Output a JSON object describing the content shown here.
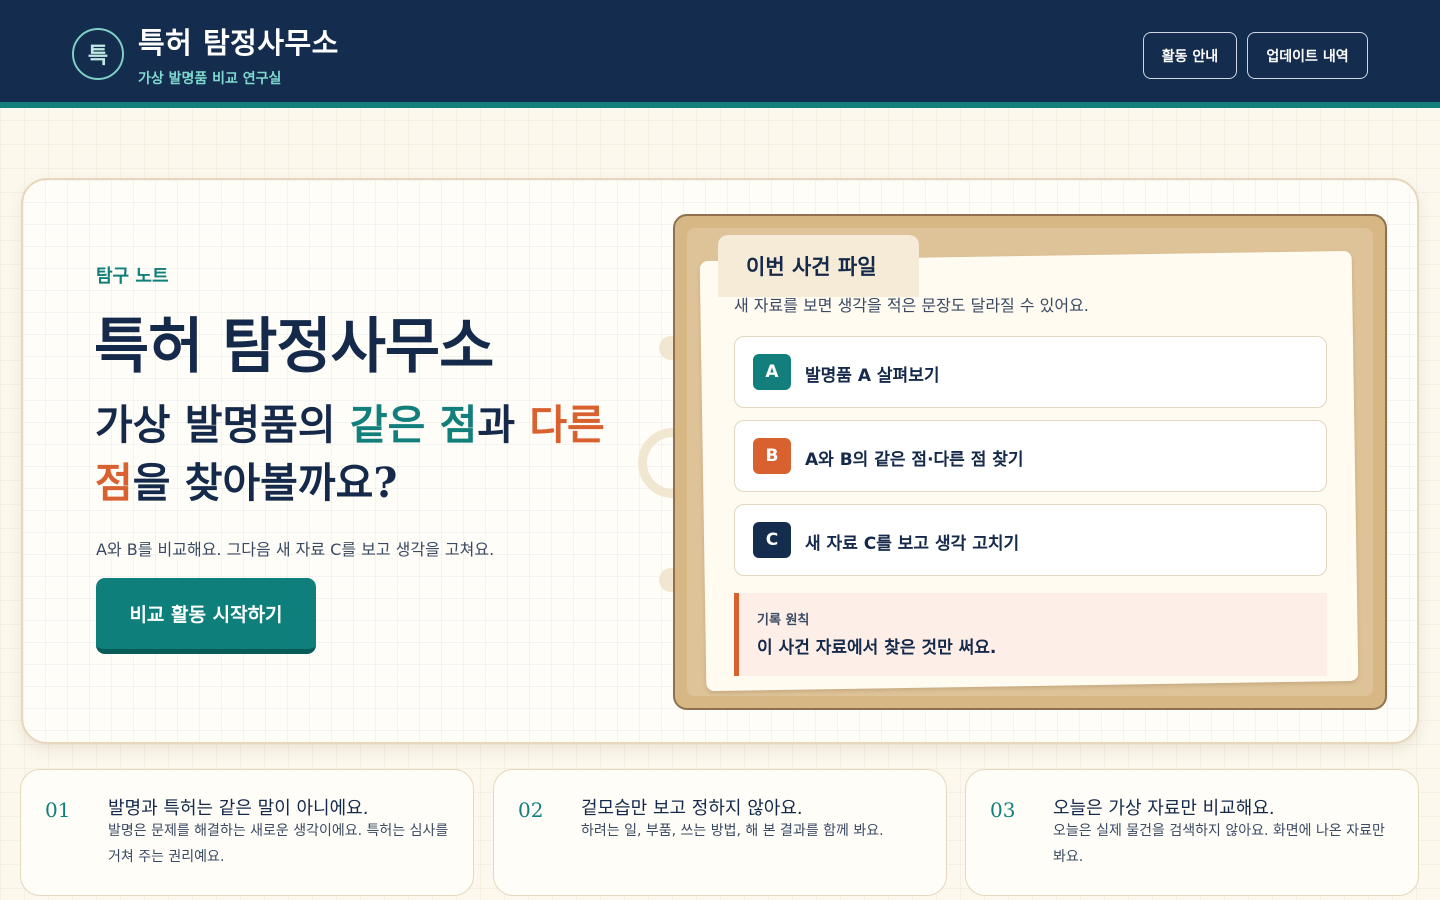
{
  "header": {
    "logo_glyph": "특",
    "title": "특허 탐정사무소",
    "subtitle": "가상 발명품 비교 연구실",
    "nav": [
      {
        "label": "활동 안내"
      },
      {
        "label": "업데이트 내역"
      }
    ]
  },
  "hero": {
    "eyebrow": "탐구 노트",
    "title": "특허 탐정사무소",
    "question": {
      "part1": "가상 발명품의 ",
      "same": "같은 점",
      "part2": "과 ",
      "diff": "다른 점",
      "part3": "을 찾아볼까요?"
    },
    "description": "A와 B를 비교해요. 그다음 새 자료 C를 보고 생각을 고쳐요.",
    "cta_label": "비교 활동 시작하기"
  },
  "case_file": {
    "tab_label": "이번 사건 파일",
    "note": "새 자료를 보면 생각을 적은 문장도 달라질 수 있어요.",
    "steps": [
      {
        "badge": "A",
        "label": "발명품 A 살펴보기",
        "color": "#127f7c"
      },
      {
        "badge": "B",
        "label": "A와 B의 같은 점·다른 점 찾기",
        "color": "#d9602f"
      },
      {
        "badge": "C",
        "label": "새 자료 C를 보고 생각 고치기",
        "color": "#142c4e"
      }
    ],
    "rule": {
      "title": "기록 원칙",
      "text": "이 사건 자료에서 찾은 것만 써요."
    }
  },
  "info_cards": [
    {
      "num": "01",
      "title": "발명과 특허는 같은 말이 아니에요.",
      "text": "발명은 문제를 해결하는 새로운 생각이에요. 특허는 심사를 거쳐 주는 권리예요."
    },
    {
      "num": "02",
      "title": "겉모습만 보고 정하지 않아요.",
      "text": "하려는 일, 부품, 쓰는 방법, 해 본 결과를 함께 봐요."
    },
    {
      "num": "03",
      "title": "오늘은 가상 자료만 비교해요.",
      "text": "오늘은 실제 물건을 검색하지 않아요. 화면에 나온 자료만 봐요."
    }
  ]
}
